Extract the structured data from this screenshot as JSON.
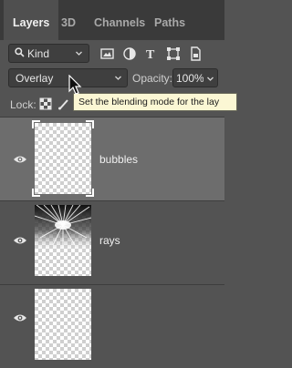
{
  "tabs": [
    {
      "label": "Layers",
      "active": true
    },
    {
      "label": "3D",
      "active": false
    },
    {
      "label": "Channels",
      "active": false
    },
    {
      "label": "Paths",
      "active": false
    }
  ],
  "filter": {
    "kind_label": "Kind",
    "filter_icons": [
      "image-filter-icon",
      "adjustment-filter-icon",
      "type-filter-icon",
      "shape-filter-icon",
      "smart-object-filter-icon"
    ]
  },
  "blend": {
    "mode": "Overlay",
    "opacity_label": "Opacity:",
    "opacity_value": "100%"
  },
  "lock": {
    "label": "Lock:",
    "icons": [
      "lock-transparent-pixels-icon",
      "lock-image-pixels-icon"
    ]
  },
  "tooltip": {
    "text": "Set the blending mode for the lay"
  },
  "layers": [
    {
      "name": "bubbles",
      "visible": true,
      "selected": true
    },
    {
      "name": "rays",
      "visible": true,
      "selected": false
    },
    {
      "name": "",
      "visible": true,
      "selected": false
    }
  ],
  "colors": {
    "panel_bg": "#535353",
    "selected_row": "#6d6d6d",
    "tabbar_bg": "#3a3a3a",
    "tooltip_bg": "#fbf7d4"
  }
}
